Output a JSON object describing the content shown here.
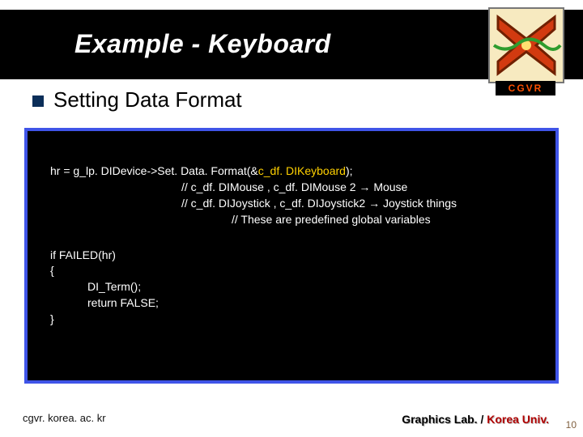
{
  "header": {
    "title": "Example - Keyboard",
    "logo_label": "CGVR"
  },
  "section": {
    "heading": "Setting Data Format"
  },
  "code": {
    "line1_a": "hr = g_lp. DIDevice->Set. Data. Format(&",
    "line1_b": "c_df. DIKeyboard",
    "line1_c": ");",
    "line2": "// c_df. DIMouse   , c_df. DIMouse 2    → Mouse",
    "line3": "// c_df. DIJoystick , c_df. DIJoystick2   → Joystick things",
    "line4": "// These are predefined global variables",
    "err1": "if FAILED(hr)",
    "err2": "{",
    "err3": "DI_Term();",
    "err4": "return FALSE;",
    "err5": "}"
  },
  "footer": {
    "left": "cgvr. korea. ac. kr",
    "right_a": "Graphics Lab.",
    "right_sep": " / ",
    "right_b": "Korea Univ.",
    "page_num": "10"
  }
}
